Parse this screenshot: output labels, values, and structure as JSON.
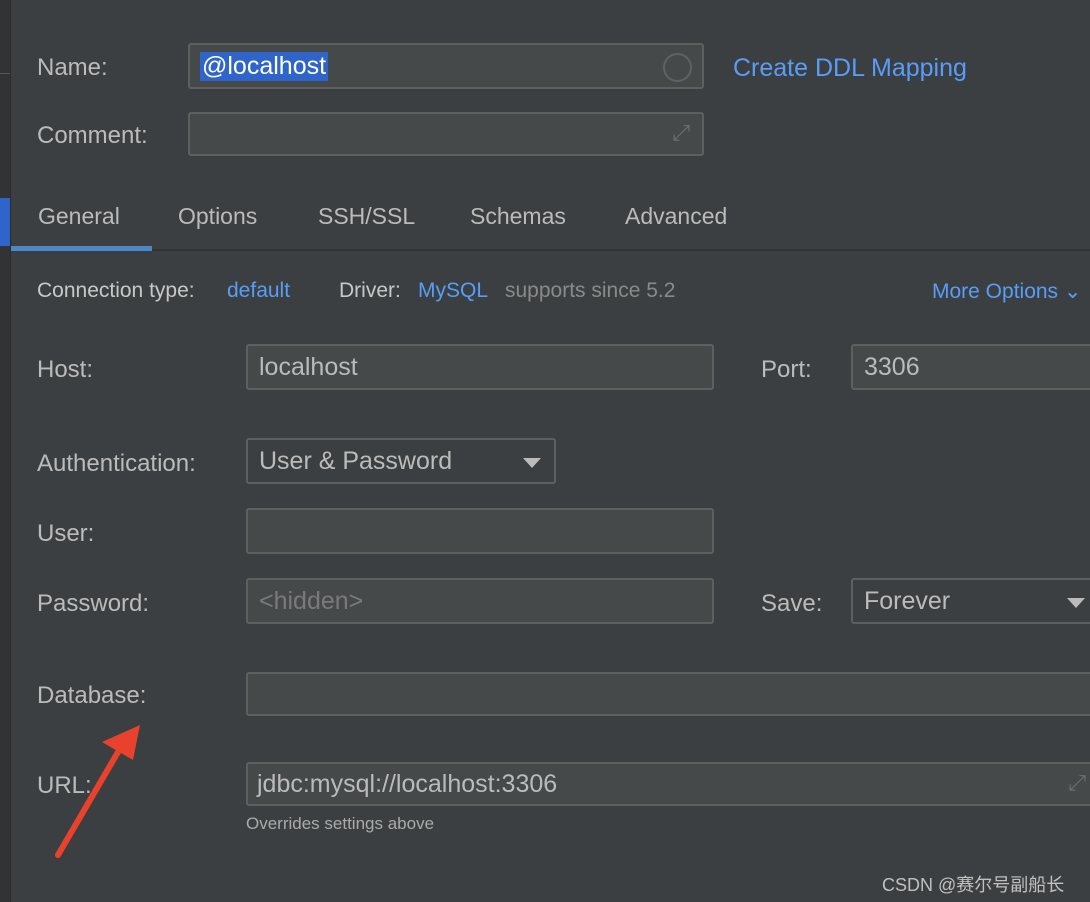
{
  "name": {
    "label": "Name:",
    "value": "@localhost"
  },
  "comment": {
    "label": "Comment:",
    "value": ""
  },
  "create_ddl": "Create DDL Mapping",
  "tabs": [
    {
      "label": "General",
      "active": true
    },
    {
      "label": "Options"
    },
    {
      "label": "SSH/SSL"
    },
    {
      "label": "Schemas"
    },
    {
      "label": "Advanced"
    }
  ],
  "connection": {
    "type_label": "Connection type:",
    "type_value": "default",
    "driver_label": "Driver:",
    "driver_value": "MySQL",
    "driver_note": "supports since 5.2",
    "more_options": "More Options"
  },
  "host": {
    "label": "Host:",
    "value": "localhost"
  },
  "port": {
    "label": "Port:",
    "value": "3306"
  },
  "auth": {
    "label": "Authentication:",
    "value": "User & Password"
  },
  "user": {
    "label": "User:",
    "value": ""
  },
  "password": {
    "label": "Password:",
    "placeholder": "<hidden>"
  },
  "save": {
    "label": "Save:",
    "value": "Forever"
  },
  "database": {
    "label": "Database:",
    "value": ""
  },
  "url": {
    "label": "URL:",
    "value": "jdbc:mysql://localhost:3306",
    "note": "Overrides settings above"
  },
  "watermark": "CSDN @赛尔号副船长",
  "colors": {
    "accent": "#589df6",
    "selection": "#2f65ca",
    "annotation_arrow": "#e8412c"
  }
}
